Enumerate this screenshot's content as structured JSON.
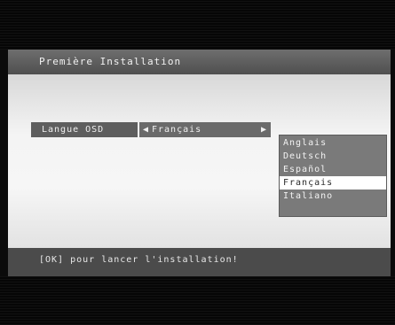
{
  "window": {
    "title": "Première Installation"
  },
  "setting": {
    "label": "Langue OSD",
    "value": "Français",
    "arrow_left": "◀",
    "arrow_right": "▶"
  },
  "dropdown": {
    "options": [
      "Anglais",
      "Deutsch",
      "Español",
      "Français",
      "Italiano"
    ],
    "selected_index": 3
  },
  "footer": {
    "hint": "[OK] pour lancer l'installation!"
  },
  "colors": {
    "title_bar": "#5e5e5e",
    "content_bg": "#f0f0f0",
    "selected_bg": "#ffffff",
    "dropdown_bg": "#7a7a7a",
    "footer_bar": "#4b4b4b"
  }
}
